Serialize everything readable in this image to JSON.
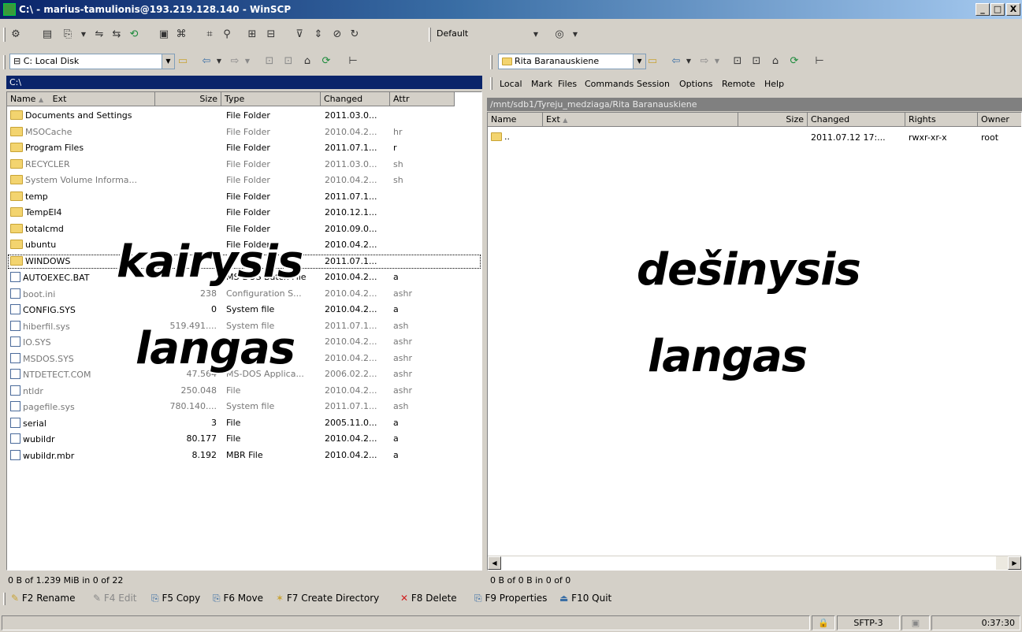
{
  "window": {
    "title": "C:\\ - marius-tamulionis@193.219.128.140 - WinSCP",
    "min": "_",
    "max": "□",
    "close": "X"
  },
  "toolbar": {
    "session_combo": "Default"
  },
  "left": {
    "drive": "C: Local Disk",
    "path": "C:\\",
    "columns": [
      "Name",
      "Ext",
      "Size",
      "Type",
      "Changed",
      "Attr"
    ],
    "rows": [
      {
        "name": "Documents and Settings",
        "size": "",
        "type": "File Folder",
        "changed": "2011.03.0...",
        "attr": "",
        "icon": "folder",
        "grey": false
      },
      {
        "name": "MSOCache",
        "size": "",
        "type": "File Folder",
        "changed": "2010.04.2...",
        "attr": "hr",
        "icon": "folder",
        "grey": true
      },
      {
        "name": "Program Files",
        "size": "",
        "type": "File Folder",
        "changed": "2011.07.1...",
        "attr": "r",
        "icon": "folder",
        "grey": false
      },
      {
        "name": "RECYCLER",
        "size": "",
        "type": "File Folder",
        "changed": "2011.03.0...",
        "attr": "sh",
        "icon": "folder",
        "grey": true
      },
      {
        "name": "System Volume Informa...",
        "size": "",
        "type": "File Folder",
        "changed": "2010.04.2...",
        "attr": "sh",
        "icon": "folder",
        "grey": true
      },
      {
        "name": "temp",
        "size": "",
        "type": "File Folder",
        "changed": "2011.07.1...",
        "attr": "",
        "icon": "folder",
        "grey": false
      },
      {
        "name": "TempEI4",
        "size": "",
        "type": "File Folder",
        "changed": "2010.12.1...",
        "attr": "",
        "icon": "folder",
        "grey": false
      },
      {
        "name": "totalcmd",
        "size": "",
        "type": "File Folder",
        "changed": "2010.09.0...",
        "attr": "",
        "icon": "folder",
        "grey": false
      },
      {
        "name": "ubuntu",
        "size": "",
        "type": "File Folder",
        "changed": "2010.04.2...",
        "attr": "",
        "icon": "folder",
        "grey": false
      },
      {
        "name": "WINDOWS",
        "size": "",
        "type": "",
        "changed": "2011.07.1...",
        "attr": "",
        "icon": "folder",
        "grey": false
      },
      {
        "name": "AUTOEXEC.BAT",
        "size": "",
        "type": "MS-DOS Batch File",
        "changed": "2010.04.2...",
        "attr": "a",
        "icon": "file",
        "grey": false
      },
      {
        "name": "boot.ini",
        "size": "238",
        "type": "Configuration S...",
        "changed": "2010.04.2...",
        "attr": "ashr",
        "icon": "file",
        "grey": true
      },
      {
        "name": "CONFIG.SYS",
        "size": "0",
        "type": "System file",
        "changed": "2010.04.2...",
        "attr": "a",
        "icon": "file",
        "grey": false
      },
      {
        "name": "hiberfil.sys",
        "size": "519.491....",
        "type": "System file",
        "changed": "2011.07.1...",
        "attr": "ash",
        "icon": "file",
        "grey": true
      },
      {
        "name": "IO.SYS",
        "size": "",
        "type": "",
        "changed": "2010.04.2...",
        "attr": "ashr",
        "icon": "file",
        "grey": true
      },
      {
        "name": "MSDOS.SYS",
        "size": "",
        "type": "",
        "changed": "2010.04.2...",
        "attr": "ashr",
        "icon": "file",
        "grey": true
      },
      {
        "name": "NTDETECT.COM",
        "size": "47.564",
        "type": "MS-DOS Applica...",
        "changed": "2006.02.2...",
        "attr": "ashr",
        "icon": "file",
        "grey": true
      },
      {
        "name": "ntldr",
        "size": "250.048",
        "type": "File",
        "changed": "2010.04.2...",
        "attr": "ashr",
        "icon": "file",
        "grey": true
      },
      {
        "name": "pagefile.sys",
        "size": "780.140....",
        "type": "System file",
        "changed": "2011.07.1...",
        "attr": "ash",
        "icon": "file",
        "grey": true
      },
      {
        "name": "serial",
        "size": "3",
        "type": "File",
        "changed": "2005.11.0...",
        "attr": "a",
        "icon": "file",
        "grey": false
      },
      {
        "name": "wubildr",
        "size": "80.177",
        "type": "File",
        "changed": "2010.04.2...",
        "attr": "a",
        "icon": "file",
        "grey": false
      },
      {
        "name": "wubildr.mbr",
        "size": "8.192",
        "type": "MBR File",
        "changed": "2010.04.2...",
        "attr": "a",
        "icon": "file",
        "grey": false
      }
    ],
    "status": "0 B of 1.239 MiB in 0 of 22",
    "overlay_line1": "kairysis",
    "overlay_line2": "langas"
  },
  "right": {
    "drive": "Rita Baranauskiene",
    "menu": [
      "Local",
      "Mark",
      "Files",
      "Commands",
      "Session",
      "Options",
      "Remote",
      "Help"
    ],
    "path": "/mnt/sdb1/Tyreju_medziaga/Rita Baranauskiene",
    "columns": [
      "Name",
      "Ext",
      "Size",
      "Changed",
      "Rights",
      "Owner"
    ],
    "rows": [
      {
        "name": "..",
        "changed": "2011.07.12 17:...",
        "rights": "rwxr-xr-x",
        "owner": "root"
      }
    ],
    "status": "0 B of 0 B in 0 of 0",
    "overlay_line1": "dešinysis",
    "overlay_line2": "langas"
  },
  "fkeys": [
    "F2 Rename",
    "F4 Edit",
    "F5 Copy",
    "F6 Move",
    "F7 Create Directory",
    "F8 Delete",
    "F9 Properties",
    "F10 Quit"
  ],
  "statusbar": {
    "protocol": "SFTP-3",
    "time": "0:37:30"
  }
}
